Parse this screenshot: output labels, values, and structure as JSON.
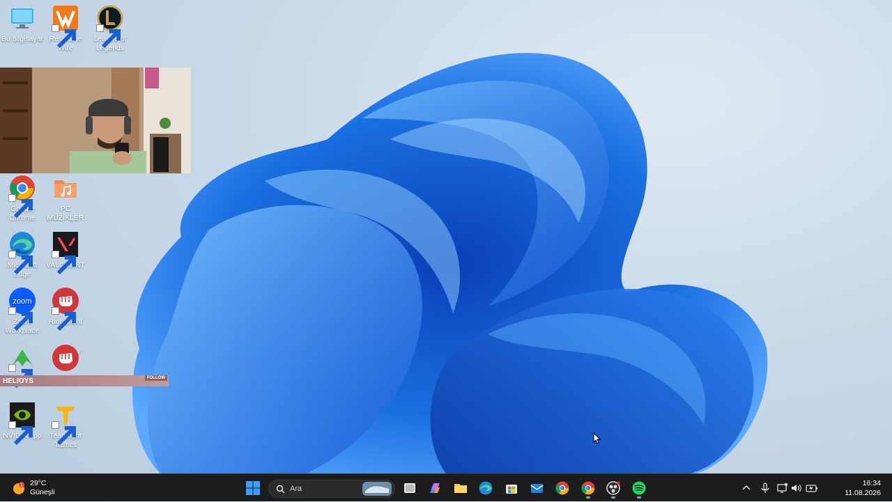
{
  "desktop": {
    "icons": [
      {
        "id": "this-pc",
        "label": "Bu bilgisayar"
      },
      {
        "id": "resolume",
        "label": "Resolume Wire"
      },
      {
        "id": "lol",
        "label": "League of Legends"
      },
      {
        "id": "chrome",
        "label": "Google Chrome"
      },
      {
        "id": "pc-music",
        "label": "PC MÜZİKLER"
      },
      {
        "id": "edge",
        "label": "Microsoft Edge"
      },
      {
        "id": "valorant",
        "label": "VALORANT"
      },
      {
        "id": "zoom",
        "label": "Zoom Workplace"
      },
      {
        "id": "riot",
        "label": "Riot Client"
      },
      {
        "id": "nvidia",
        "label": "NVIDIA App"
      },
      {
        "id": "tft",
        "label": "Teamfight Tactics"
      }
    ]
  },
  "overlay": {
    "streamer_name": "HELIOYS",
    "follow_label": "FOLLOW"
  },
  "taskbar": {
    "weather": {
      "temperature": "29°C",
      "condition": "Güneşli"
    },
    "search_placeholder": "Ara",
    "clock": {
      "time": "16:34",
      "date": "11.08.2026"
    },
    "apps": [
      "start",
      "search",
      "widgets",
      "task-view",
      "copilot",
      "file-explorer",
      "edge",
      "store",
      "outlook",
      "chrome",
      "chrome-2",
      "obs",
      "spotify"
    ]
  },
  "colors": {
    "taskbar": "#1c1c1c",
    "wallpaper_accent": "#1a6fe0"
  }
}
